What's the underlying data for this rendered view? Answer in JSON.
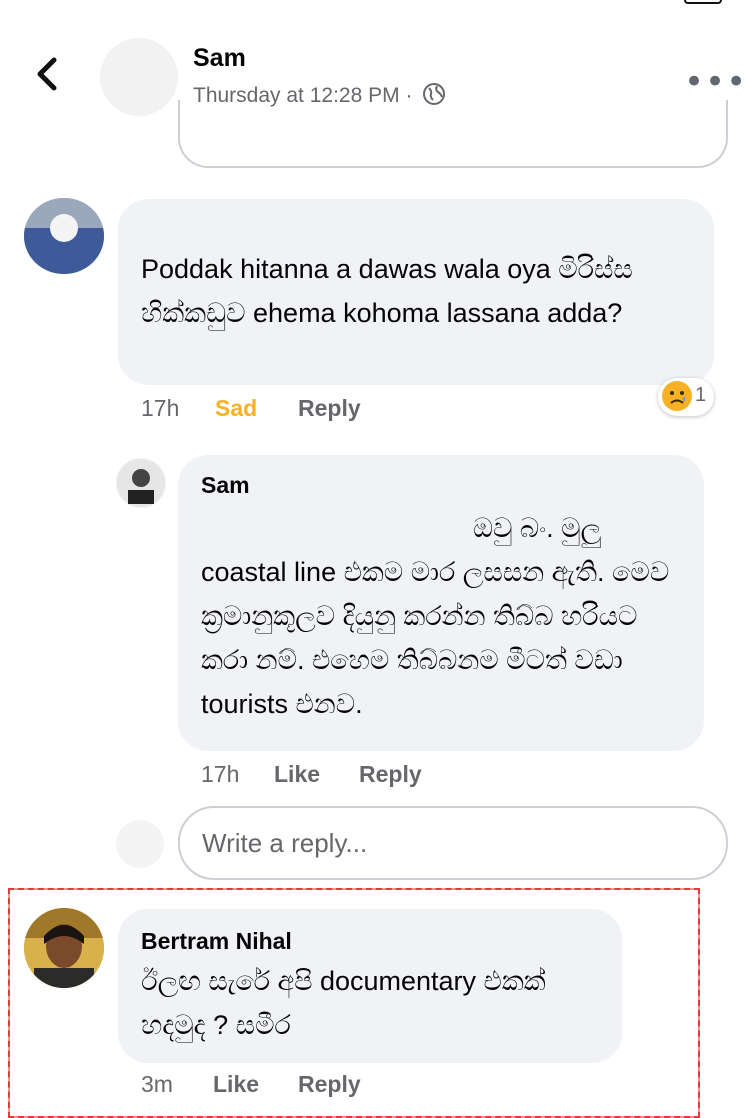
{
  "header": {
    "author_name": "Sam",
    "timestamp": "Thursday at 12:28 PM · ",
    "privacy_icon": "globe-icon",
    "more_icon": "more-icon",
    "back_icon": "back-chevron-icon"
  },
  "comments": [
    {
      "text": "Poddak hitanna a dawas wala oya මිරිස්ස හික්කඩුව ehema kohoma lassana adda?",
      "time": "17h",
      "reaction_label": "Sad",
      "reply_label": "Reply",
      "reaction_count": "1"
    },
    {
      "author": "Sam",
      "text": "ඔවු බං. මුලු coastal line එකම මාර ලසසන ඇති. මෙව ක්‍රමානුකූලව දියුනු කරන්න තිබ්බ හරියට කරා නම්. එහෙම තිබ්බනම මීටත් වඩා tourists එනව.",
      "time": "17h",
      "like_label": "Like",
      "reply_label": "Reply"
    },
    {
      "author": "Bertram Nihal",
      "text": "ඊලඟ සැරේ අපි documentary එකක් හදමුද ? සමීර",
      "time": "3m",
      "like_label": "Like",
      "reply_label": "Reply"
    }
  ],
  "reply_input": {
    "placeholder": "Write a reply..."
  },
  "colors": {
    "bubble": "#f0f2f5",
    "meta": "#65676b",
    "sad": "#f7b125",
    "highlight": "#e23b3b"
  }
}
